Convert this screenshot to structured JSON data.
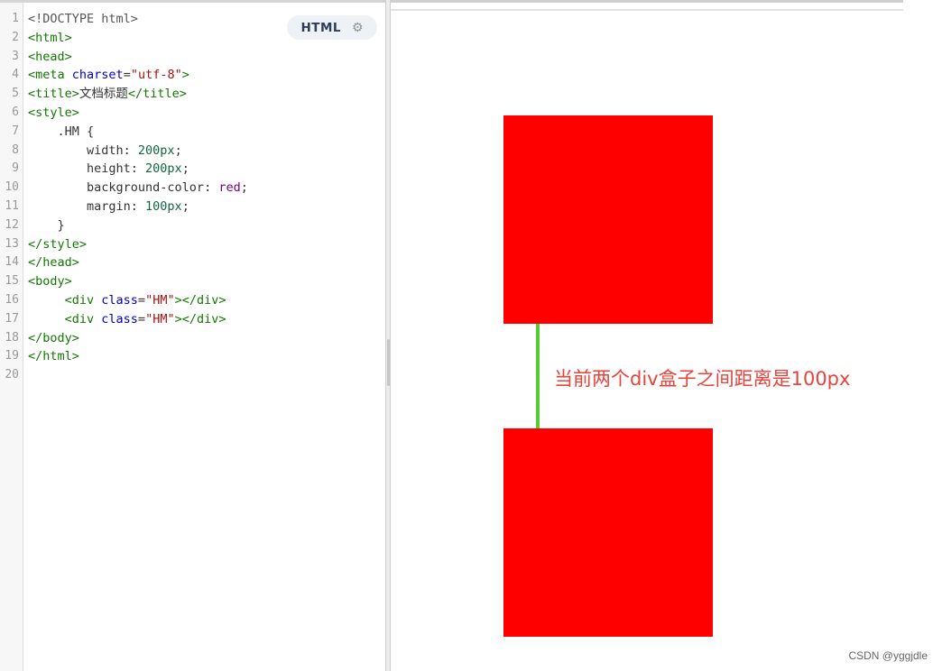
{
  "editor": {
    "language_label": "HTML",
    "settings_icon": "gear-icon",
    "line_numbers": [
      "1",
      "2",
      "3",
      "4",
      "5",
      "6",
      "7",
      "8",
      "9",
      "10",
      "11",
      "12",
      "13",
      "14",
      "15",
      "16",
      "17",
      "18",
      "19",
      "20"
    ],
    "lines": [
      [
        {
          "c": "t-meta",
          "t": "<!DOCTYPE html>"
        }
      ],
      [
        {
          "c": "t-tag",
          "t": "<html>"
        }
      ],
      [
        {
          "c": "t-tag",
          "t": "<head>"
        }
      ],
      [
        {
          "c": "t-tag",
          "t": "<meta "
        },
        {
          "c": "t-attr",
          "t": "charset"
        },
        {
          "c": "t-plain",
          "t": "="
        },
        {
          "c": "t-str",
          "t": "\"utf-8\""
        },
        {
          "c": "t-tag",
          "t": ">"
        }
      ],
      [
        {
          "c": "t-tag",
          "t": "<title>"
        },
        {
          "c": "t-plain",
          "t": "文档标题"
        },
        {
          "c": "t-tag",
          "t": "</title>"
        }
      ],
      [
        {
          "c": "t-tag",
          "t": "<style>"
        }
      ],
      [
        {
          "c": "t-sel",
          "t": "    .HM {"
        }
      ],
      [
        {
          "c": "t-prop",
          "t": "        width: "
        },
        {
          "c": "t-num",
          "t": "200px"
        },
        {
          "c": "t-plain",
          "t": ";"
        }
      ],
      [
        {
          "c": "t-prop",
          "t": "        height: "
        },
        {
          "c": "t-num",
          "t": "200px"
        },
        {
          "c": "t-plain",
          "t": ";"
        }
      ],
      [
        {
          "c": "t-prop",
          "t": "        background-color: "
        },
        {
          "c": "t-kw",
          "t": "red"
        },
        {
          "c": "t-plain",
          "t": ";"
        }
      ],
      [
        {
          "c": "t-prop",
          "t": "        margin: "
        },
        {
          "c": "t-num",
          "t": "100px"
        },
        {
          "c": "t-plain",
          "t": ";"
        }
      ],
      [
        {
          "c": "t-sel",
          "t": "    }"
        }
      ],
      [
        {
          "c": "t-tag",
          "t": "</style>"
        }
      ],
      [
        {
          "c": "t-tag",
          "t": "</head>"
        }
      ],
      [
        {
          "c": "t-tag",
          "t": "<body>"
        }
      ],
      [
        {
          "c": "t-plain",
          "t": "     "
        },
        {
          "c": "t-tag",
          "t": "<div "
        },
        {
          "c": "t-attr",
          "t": "class"
        },
        {
          "c": "t-plain",
          "t": "="
        },
        {
          "c": "t-str",
          "t": "\"HM\""
        },
        {
          "c": "t-tag",
          "t": "></div>"
        }
      ],
      [
        {
          "c": "t-plain",
          "t": "     "
        },
        {
          "c": "t-tag",
          "t": "<div "
        },
        {
          "c": "t-attr",
          "t": "class"
        },
        {
          "c": "t-plain",
          "t": "="
        },
        {
          "c": "t-str",
          "t": "\"HM\""
        },
        {
          "c": "t-tag",
          "t": "></div>"
        }
      ],
      [
        {
          "c": "t-tag",
          "t": "</body>"
        }
      ],
      [
        {
          "c": "t-tag",
          "t": "</html>"
        }
      ],
      []
    ]
  },
  "preview": {
    "box_color": "#ff0000",
    "marker_color": "#55cc33",
    "annotation_text": "当前两个div盒子之间距离是100px",
    "annotation_color": "#e8433a"
  },
  "watermark": "CSDN @yggjdle"
}
